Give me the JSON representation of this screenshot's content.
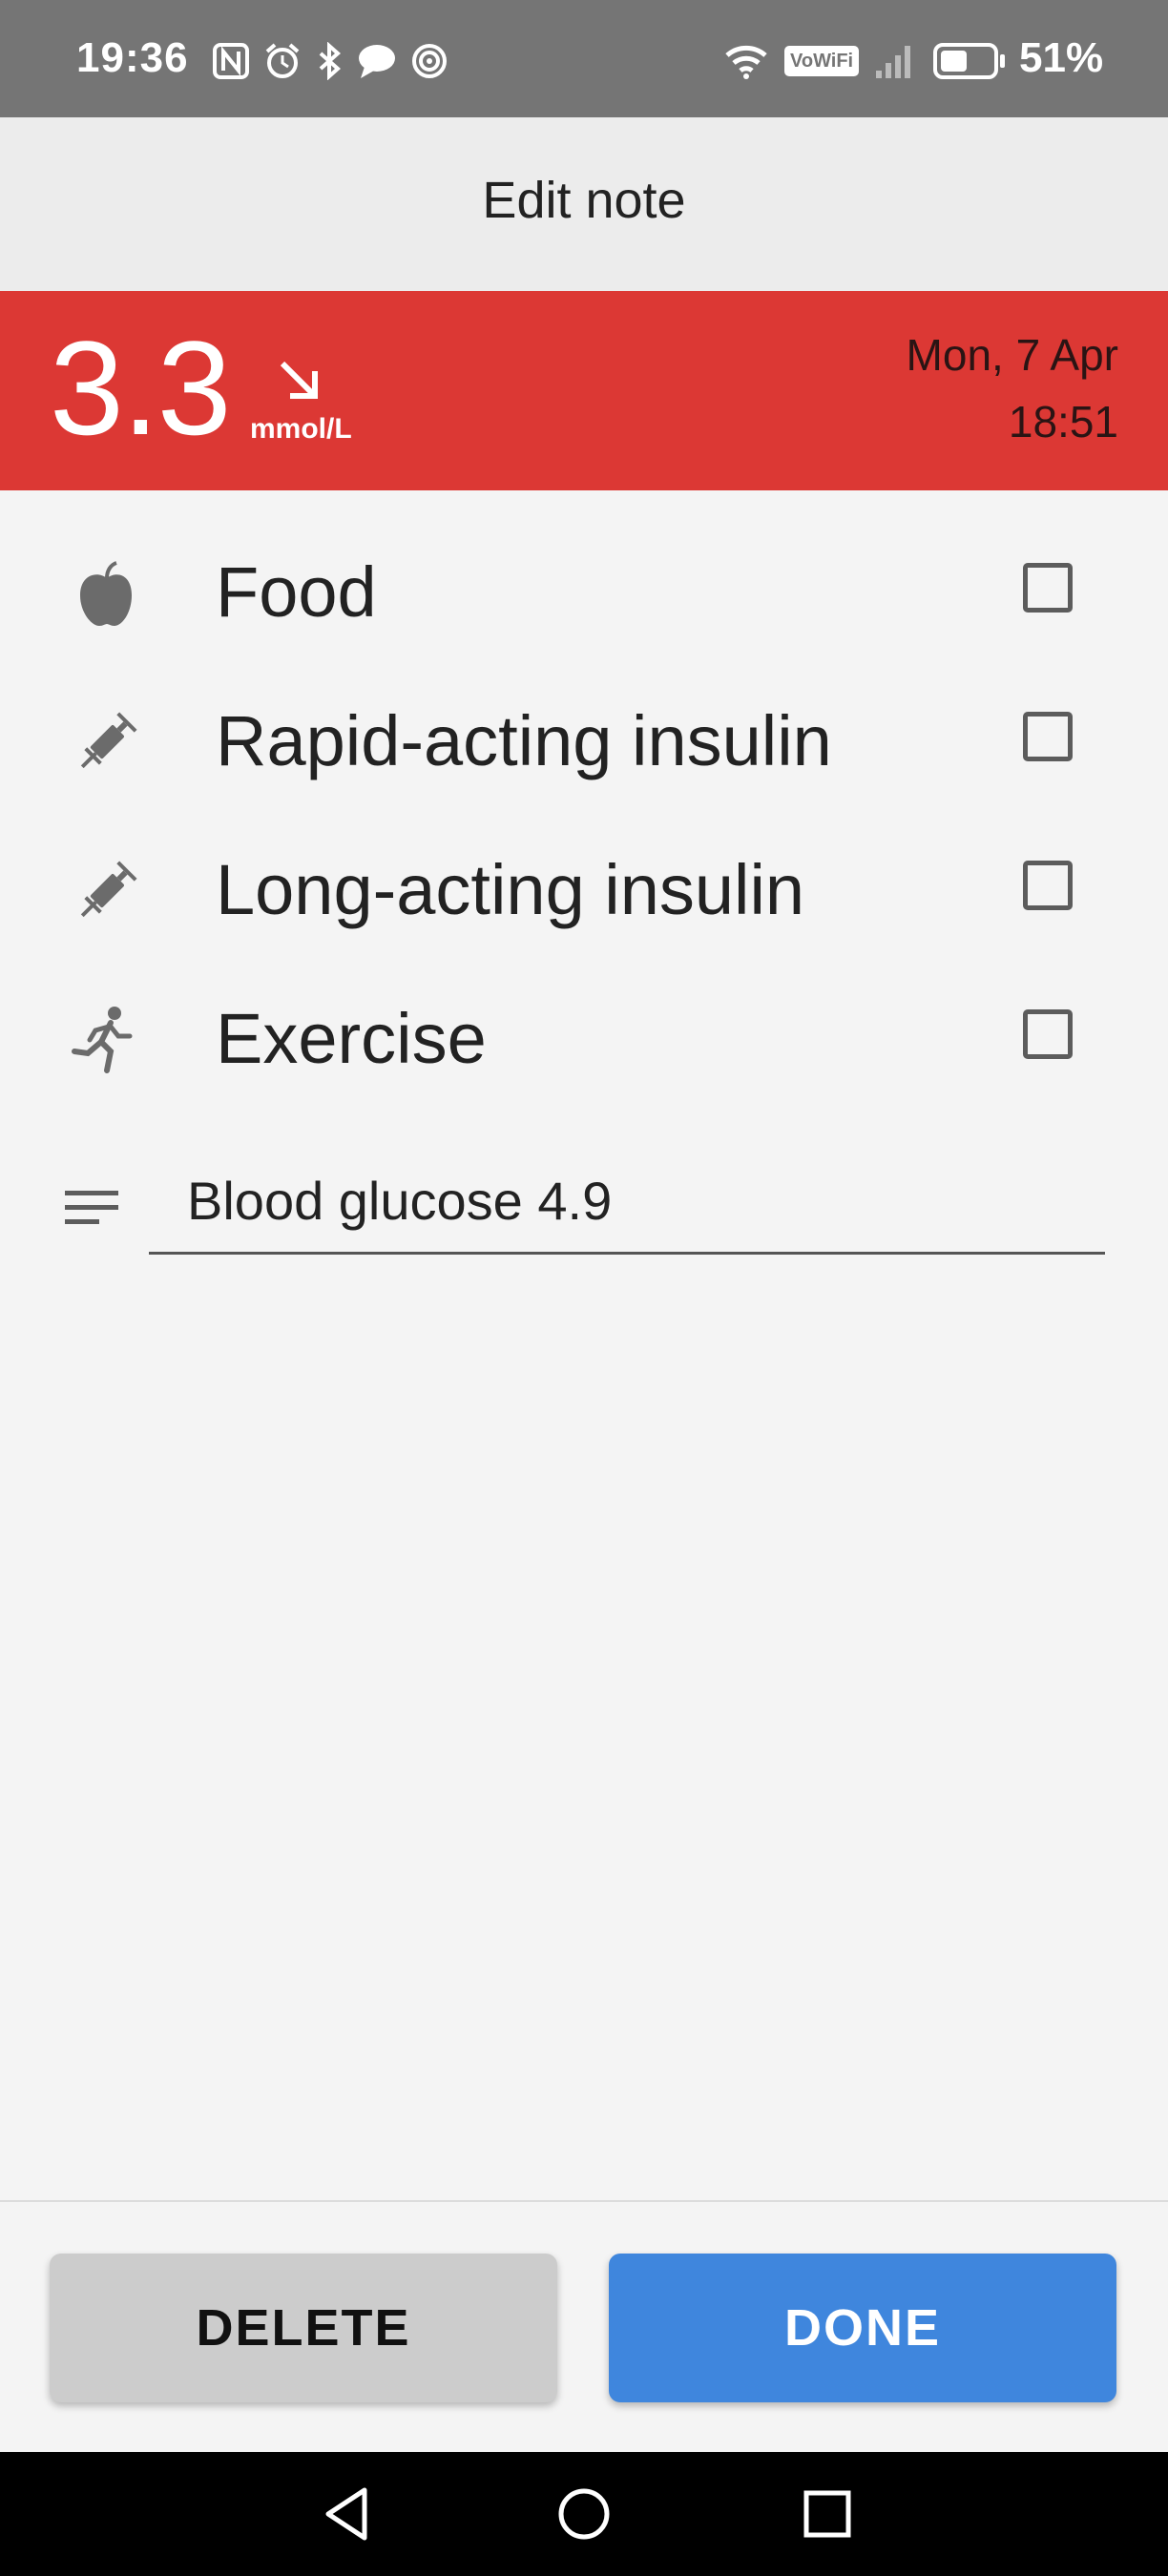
{
  "status_bar": {
    "time": "19:36",
    "left_icons": [
      "nfc-icon",
      "alarm-icon",
      "bluetooth-icon",
      "chat-icon",
      "hotspot-icon"
    ],
    "right_icons": [
      "wifi-icon",
      "vowifi-badge",
      "signal-icon",
      "battery-icon"
    ],
    "vowifi": "VoWiFi",
    "battery_pct": "51%",
    "battery_level": 0.51
  },
  "app_bar": {
    "title": "Edit note"
  },
  "reading": {
    "value": "3.3",
    "unit": "mmol/L",
    "trend_icon": "arrow-down-right-icon",
    "date": "Mon, 7 Apr",
    "time": "18:51",
    "color": "#dc3834"
  },
  "options": [
    {
      "label": "Food",
      "icon": "apple-icon",
      "checked": false
    },
    {
      "label": "Rapid-acting insulin",
      "icon": "syringe-icon",
      "checked": false
    },
    {
      "label": "Long-acting insulin",
      "icon": "syringe-icon",
      "checked": false
    },
    {
      "label": "Exercise",
      "icon": "running-icon",
      "checked": false
    }
  ],
  "comment": {
    "icon": "notes-icon",
    "value": "Blood glucose 4.9"
  },
  "actions": {
    "delete_label": "DELETE",
    "done_label": "DONE",
    "done_color": "#3f86dd"
  },
  "nav": {
    "items": [
      "back-icon",
      "home-icon",
      "recents-icon"
    ]
  }
}
